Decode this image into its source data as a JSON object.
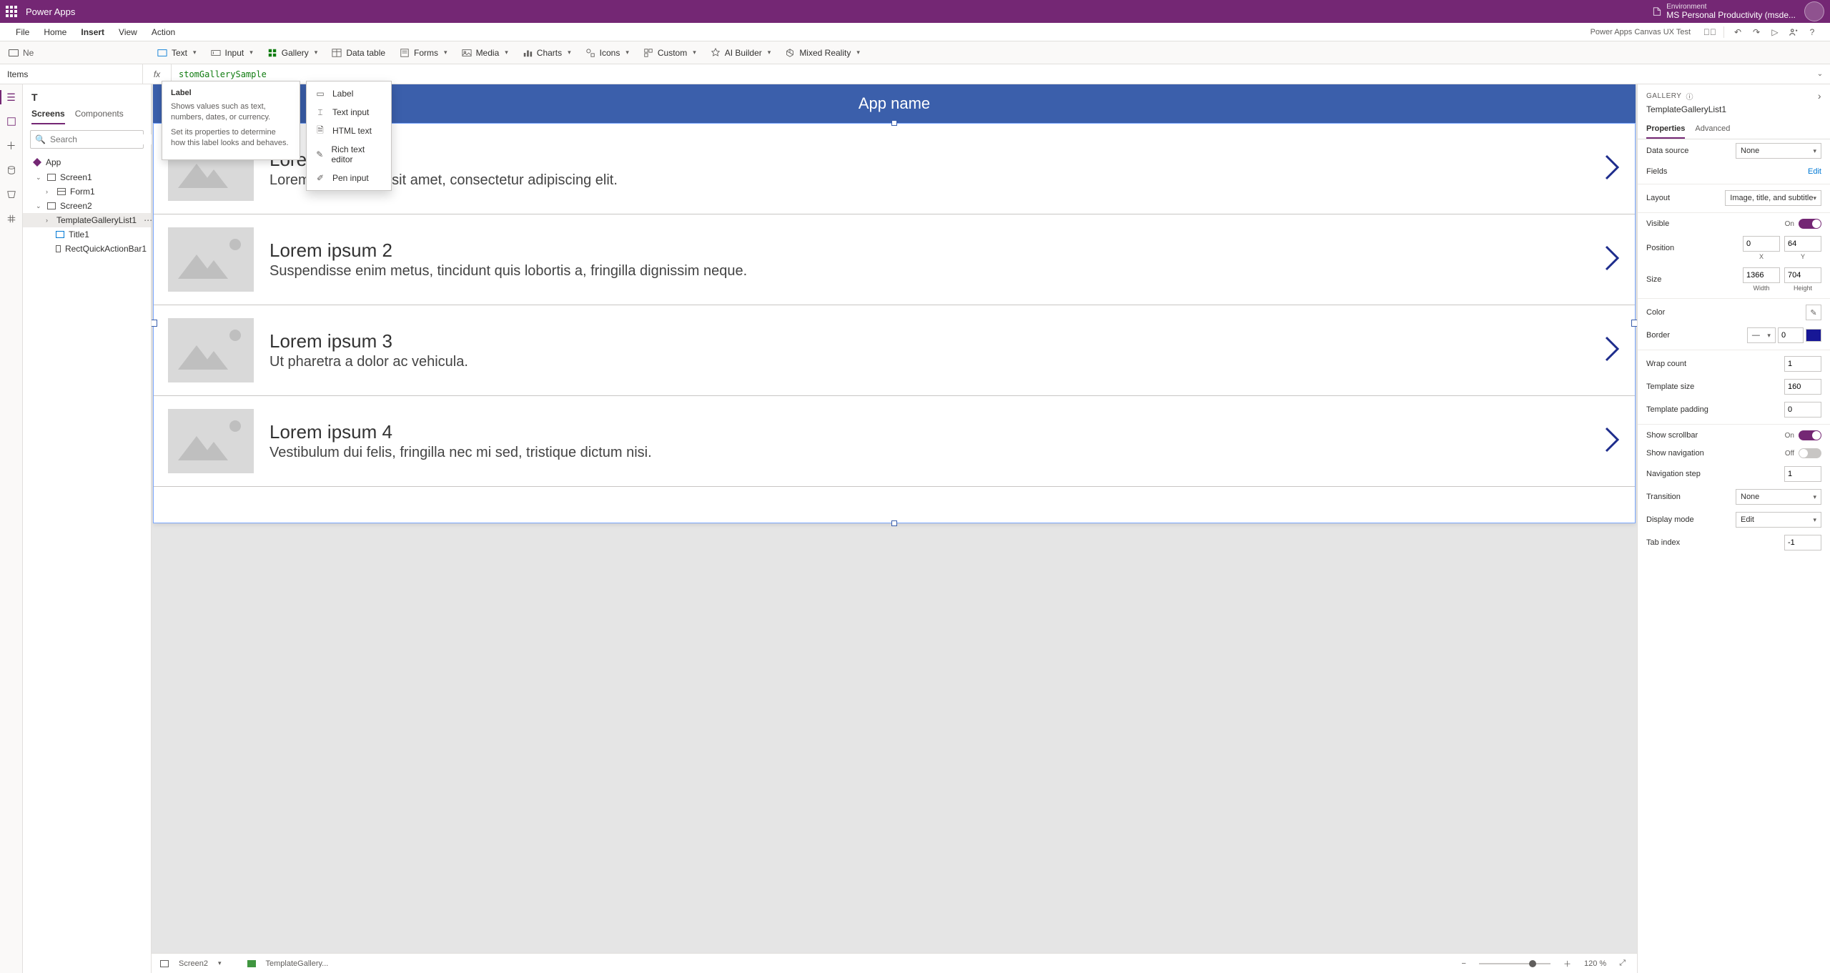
{
  "titlebar": {
    "app_name": "Power Apps",
    "env_label": "Environment",
    "env_value": "MS Personal Productivity (msde..."
  },
  "menu": {
    "items": [
      "File",
      "Home",
      "Insert",
      "View",
      "Action"
    ],
    "active_index": 2,
    "right_label": "Power Apps Canvas UX Test"
  },
  "toolbar": {
    "left_ghost": "Ne",
    "buttons": [
      {
        "label": "Text",
        "chev": true
      },
      {
        "label": "Input",
        "chev": true
      },
      {
        "label": "Gallery",
        "chev": true
      },
      {
        "label": "Data table",
        "chev": false
      },
      {
        "label": "Forms",
        "chev": true
      },
      {
        "label": "Media",
        "chev": true
      },
      {
        "label": "Charts",
        "chev": true
      },
      {
        "label": "Icons",
        "chev": true
      },
      {
        "label": "Custom",
        "chev": true
      },
      {
        "label": "AI Builder",
        "chev": true
      },
      {
        "label": "Mixed Reality",
        "chev": true
      }
    ]
  },
  "formula": {
    "prop": "Items",
    "value": "stomGallerySample"
  },
  "tree": {
    "header_visible": "T",
    "tabs": [
      "Screens",
      "Components"
    ],
    "active_tab": 0,
    "search_placeholder": "Search",
    "app_label": "App",
    "nodes": {
      "screen1": "Screen1",
      "form1": "Form1",
      "screen2": "Screen2",
      "tgl": "TemplateGalleryList1",
      "title1": "Title1",
      "rect": "RectQuickActionBar1"
    }
  },
  "tooltip": {
    "title": "Label",
    "p1": "Shows values such as text, numbers, dates, or currency.",
    "p2": "Set its properties to determine how this label looks and behaves."
  },
  "dropdown": {
    "items": [
      "Label",
      "Text input",
      "HTML text",
      "Rich text editor",
      "Pen input"
    ]
  },
  "canvas": {
    "app_title": "App name",
    "items": [
      {
        "title": "Lorem ipsum 1",
        "sub": "Lorem ipsum dolor sit amet, consectetur adipiscing elit."
      },
      {
        "title": "Lorem ipsum 2",
        "sub": "Suspendisse enim metus, tincidunt quis lobortis a, fringilla dignissim neque."
      },
      {
        "title": "Lorem ipsum 3",
        "sub": "Ut pharetra a dolor ac vehicula."
      },
      {
        "title": "Lorem ipsum 4",
        "sub": "Vestibulum dui felis, fringilla nec mi sed, tristique dictum nisi."
      }
    ]
  },
  "status": {
    "screen": "Screen2",
    "control": "TemplateGallery...",
    "zoom": "120 %"
  },
  "props": {
    "header": "GALLERY",
    "name": "TemplateGalleryList1",
    "tabs": [
      "Properties",
      "Advanced"
    ],
    "data_source": {
      "label": "Data source",
      "value": "None"
    },
    "fields": {
      "label": "Fields",
      "action": "Edit"
    },
    "layout": {
      "label": "Layout",
      "value": "Image, title, and subtitle"
    },
    "visible": {
      "label": "Visible",
      "state": "On"
    },
    "position": {
      "label": "Position",
      "x": "0",
      "y": "64",
      "xl": "X",
      "yl": "Y"
    },
    "size": {
      "label": "Size",
      "w": "1366",
      "h": "704",
      "wl": "Width",
      "hl": "Height"
    },
    "color": {
      "label": "Color"
    },
    "border": {
      "label": "Border",
      "val": "0"
    },
    "wrap": {
      "label": "Wrap count",
      "val": "1"
    },
    "tsize": {
      "label": "Template size",
      "val": "160"
    },
    "tpad": {
      "label": "Template padding",
      "val": "0"
    },
    "scrollbar": {
      "label": "Show scrollbar",
      "state": "On"
    },
    "nav": {
      "label": "Show navigation",
      "state": "Off"
    },
    "navstep": {
      "label": "Navigation step",
      "val": "1"
    },
    "transition": {
      "label": "Transition",
      "value": "None"
    },
    "dmode": {
      "label": "Display mode",
      "value": "Edit"
    },
    "tabidx": {
      "label": "Tab index",
      "val": "-1"
    }
  }
}
